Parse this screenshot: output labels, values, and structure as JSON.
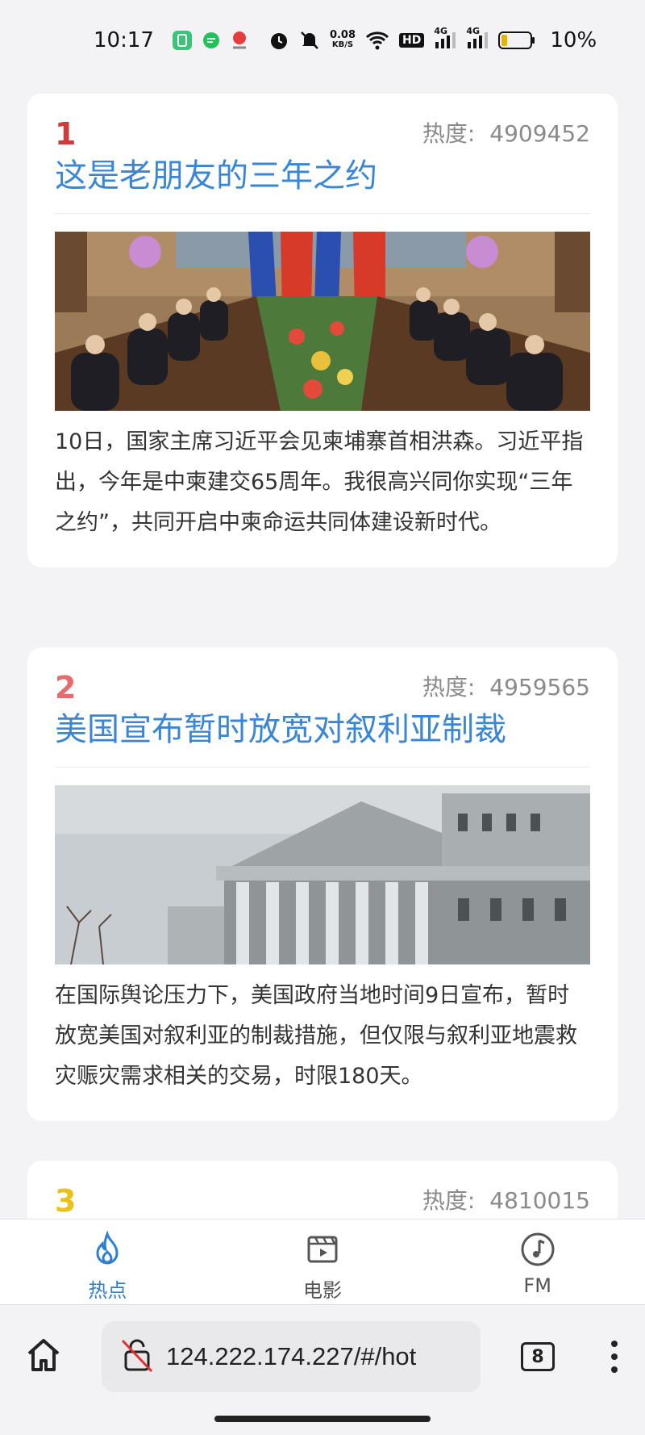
{
  "status_bar": {
    "time": "10:17",
    "net_speed_value": "0.08",
    "net_speed_unit": "KB/S",
    "hd_badge": "HD",
    "signal_1": "4G",
    "signal_2": "4G",
    "battery": "10%",
    "icons": [
      "app-notification-icon",
      "chat-bubble-icon",
      "location-app-icon",
      "alarm-icon",
      "mute-bell-icon",
      "wifi-icon",
      "hd-icon",
      "signal-icon",
      "battery-icon"
    ]
  },
  "news": [
    {
      "rank": "1",
      "rank_color": "#d03a3a",
      "heat_label": "热度:",
      "heat_value": "4909452",
      "title": "这是老朋友的三年之约",
      "summary": "10日，国家主席习近平会见柬埔寨首相洪森。习近平指出，今年是中柬建交65周年。我很高兴同你实现“三年之约”，共同开启中柬命运共同体建设新时代。"
    },
    {
      "rank": "2",
      "rank_color": "#e76b6b",
      "heat_label": "热度:",
      "heat_value": "4959565",
      "title": "美国宣布暂时放宽对叙利亚制裁",
      "summary": "在国际舆论压力下，美国政府当地时间9日宣布，暂时放宽美国对叙利亚的制裁措施，但仅限与叙利亚地震救灾赈灾需求相关的交易，时限180天。"
    },
    {
      "rank": "3",
      "rank_color": "#e8c21a",
      "heat_label": "热度:",
      "heat_value": "4810015"
    }
  ],
  "tabbar": {
    "tabs": [
      {
        "label": "热点",
        "icon": "flame-icon",
        "active": true
      },
      {
        "label": "电影",
        "icon": "film-icon",
        "active": false
      },
      {
        "label": "FM",
        "icon": "music-note-icon",
        "active": false
      }
    ],
    "active_color": "#2f7fcf"
  },
  "browser": {
    "url": "124.222.174.227/#/hot",
    "tab_count": "8"
  }
}
